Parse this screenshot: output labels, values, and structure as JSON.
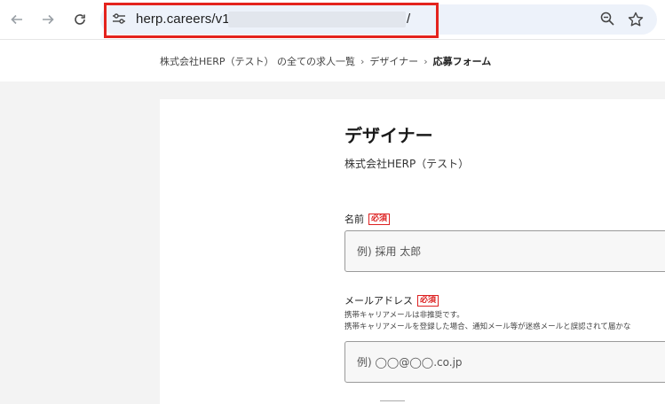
{
  "browser": {
    "url_visible": "herp.careers/v1/",
    "url_tail": "/"
  },
  "breadcrumb": {
    "items": [
      "株式会社HERP（テスト） の全ての求人一覧",
      "デザイナー"
    ],
    "current": "応募フォーム",
    "separator": "›"
  },
  "job": {
    "title": "デザイナー",
    "company": "株式会社HERP（テスト）"
  },
  "form": {
    "required_badge": "必須",
    "name": {
      "label": "名前",
      "placeholder": "例) 採用 太郎"
    },
    "email": {
      "label": "メールアドレス",
      "hint1": "携帯キャリアメールは非推奨です。",
      "hint2": "携帯キャリアメールを登録した場合、通知メール等が迷惑メールと誤認されて届かな",
      "placeholder": "例) ◯◯@◯◯.co.jp"
    }
  }
}
